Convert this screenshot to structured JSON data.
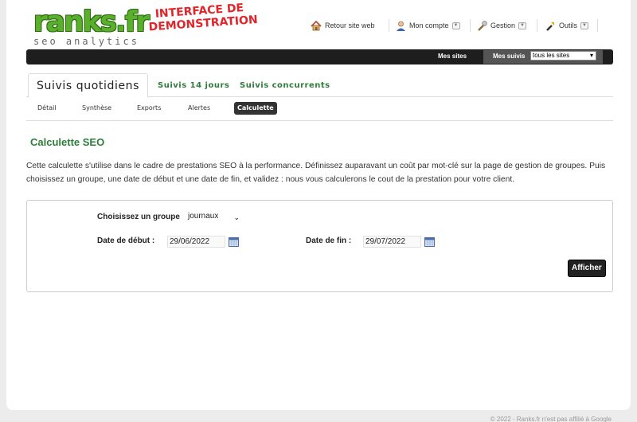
{
  "logo": {
    "mark": "ranks.fr",
    "sub": "seo analytics"
  },
  "demo_stamp": {
    "line1": "INTERFACE DE",
    "line2": "DEMONSTRATION"
  },
  "topmenu": {
    "retour": "Retour site web",
    "compte": "Mon compte",
    "gestion": "Gestion",
    "outils": "Outils"
  },
  "darkbar": {
    "mes_sites": "Mes sites",
    "mes_suivis": "Mes suivis",
    "filter_value": "tous les sites"
  },
  "tabs": {
    "active": "Suivis quotidiens",
    "tab2": "Suivis 14 jours",
    "tab3": "Suivis concurrents"
  },
  "subtabs": {
    "detail": "Détail",
    "synthese": "Synthèse",
    "exports": "Exports",
    "alertes": "Alertes",
    "calculette": "Calculette"
  },
  "section": {
    "title": "Calculette SEO",
    "description": "Cette calculette s'utilise dans le cadre de prestations SEO à la performance. Définissez auparavant un coût par mot-clé sur la page de gestion de groupes. Puis choisissez un groupe, une date de début et une date de fin, et validez : nous vous calculerons le cout de la prestation pour votre client."
  },
  "form": {
    "group_label": "Choisissez un groupe",
    "group_value": "journaux",
    "start_label": "Date de début :",
    "start_value": "29/06/2022",
    "end_label": "Date de fin :",
    "end_value": "29/07/2022",
    "submit_label": "Afficher"
  },
  "footer": "© 2022 - Ranks.fr n'est pas affilié à Google",
  "colors": {
    "brand_green": "#2e7d3a",
    "logo_green": "#5ab02c",
    "stamp_red": "#e0262b",
    "dark_bar": "#1e1e1e"
  }
}
